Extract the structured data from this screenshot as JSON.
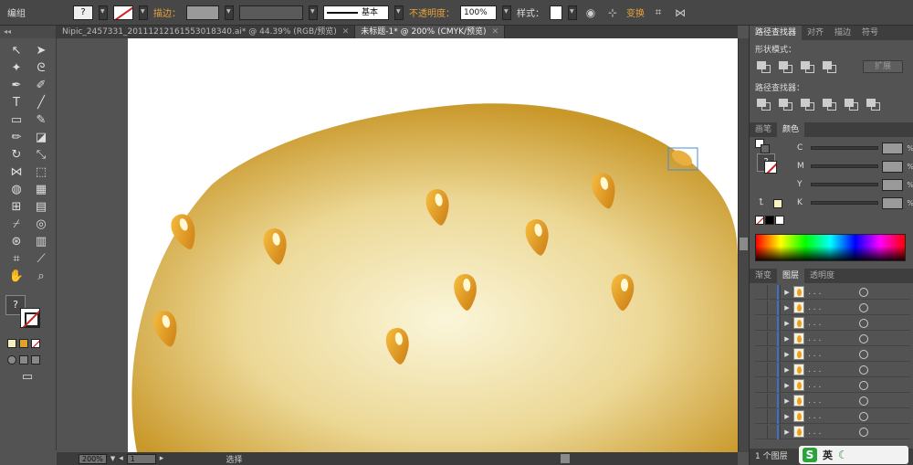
{
  "control_bar": {
    "selection_label": "编组",
    "stroke_label": "描边：",
    "brush_label": "基本",
    "opacity_label": "不透明度：",
    "opacity_value": "100%",
    "style_label": "样式：",
    "transform_label": "变换"
  },
  "tabs": [
    {
      "label": "Nipic_2457331_20111212161553018340.ai* @ 44.39% (RGB/预览)",
      "active": false
    },
    {
      "label": "未标题-1* @ 200% (CMYK/预览)",
      "active": true
    }
  ],
  "panels": {
    "pathfinder_tabs": [
      "路径查找器",
      "对齐",
      "描边",
      "符号"
    ],
    "shape_modes_label": "形状模式：",
    "expand_label": "扩展",
    "pathfinders_label": "路径查找器：",
    "color_tabs": [
      "画笔",
      "颜色"
    ],
    "cmyk": [
      {
        "letter": "C",
        "unit": "%"
      },
      {
        "letter": "M",
        "unit": "%"
      },
      {
        "letter": "Y",
        "unit": "%"
      },
      {
        "letter": "K",
        "unit": "%"
      }
    ],
    "layer_tabs": [
      "渐变",
      "图层",
      "透明度"
    ],
    "layer_items": [
      ". . .",
      ". . .",
      ". . .",
      ". . .",
      ". . .",
      ". . .",
      ". . .",
      ". . .",
      ". . .",
      ". . ."
    ],
    "layers_count": "1 个图层"
  },
  "status": {
    "zoom": "200%",
    "page": "1",
    "tool": "选择"
  },
  "ime": {
    "label": "英"
  },
  "colors": {
    "bun_light": "#fbf6da",
    "bun_mid": "#ecd896",
    "bun_dark": "#c9982a",
    "seed": "#e8a020"
  }
}
